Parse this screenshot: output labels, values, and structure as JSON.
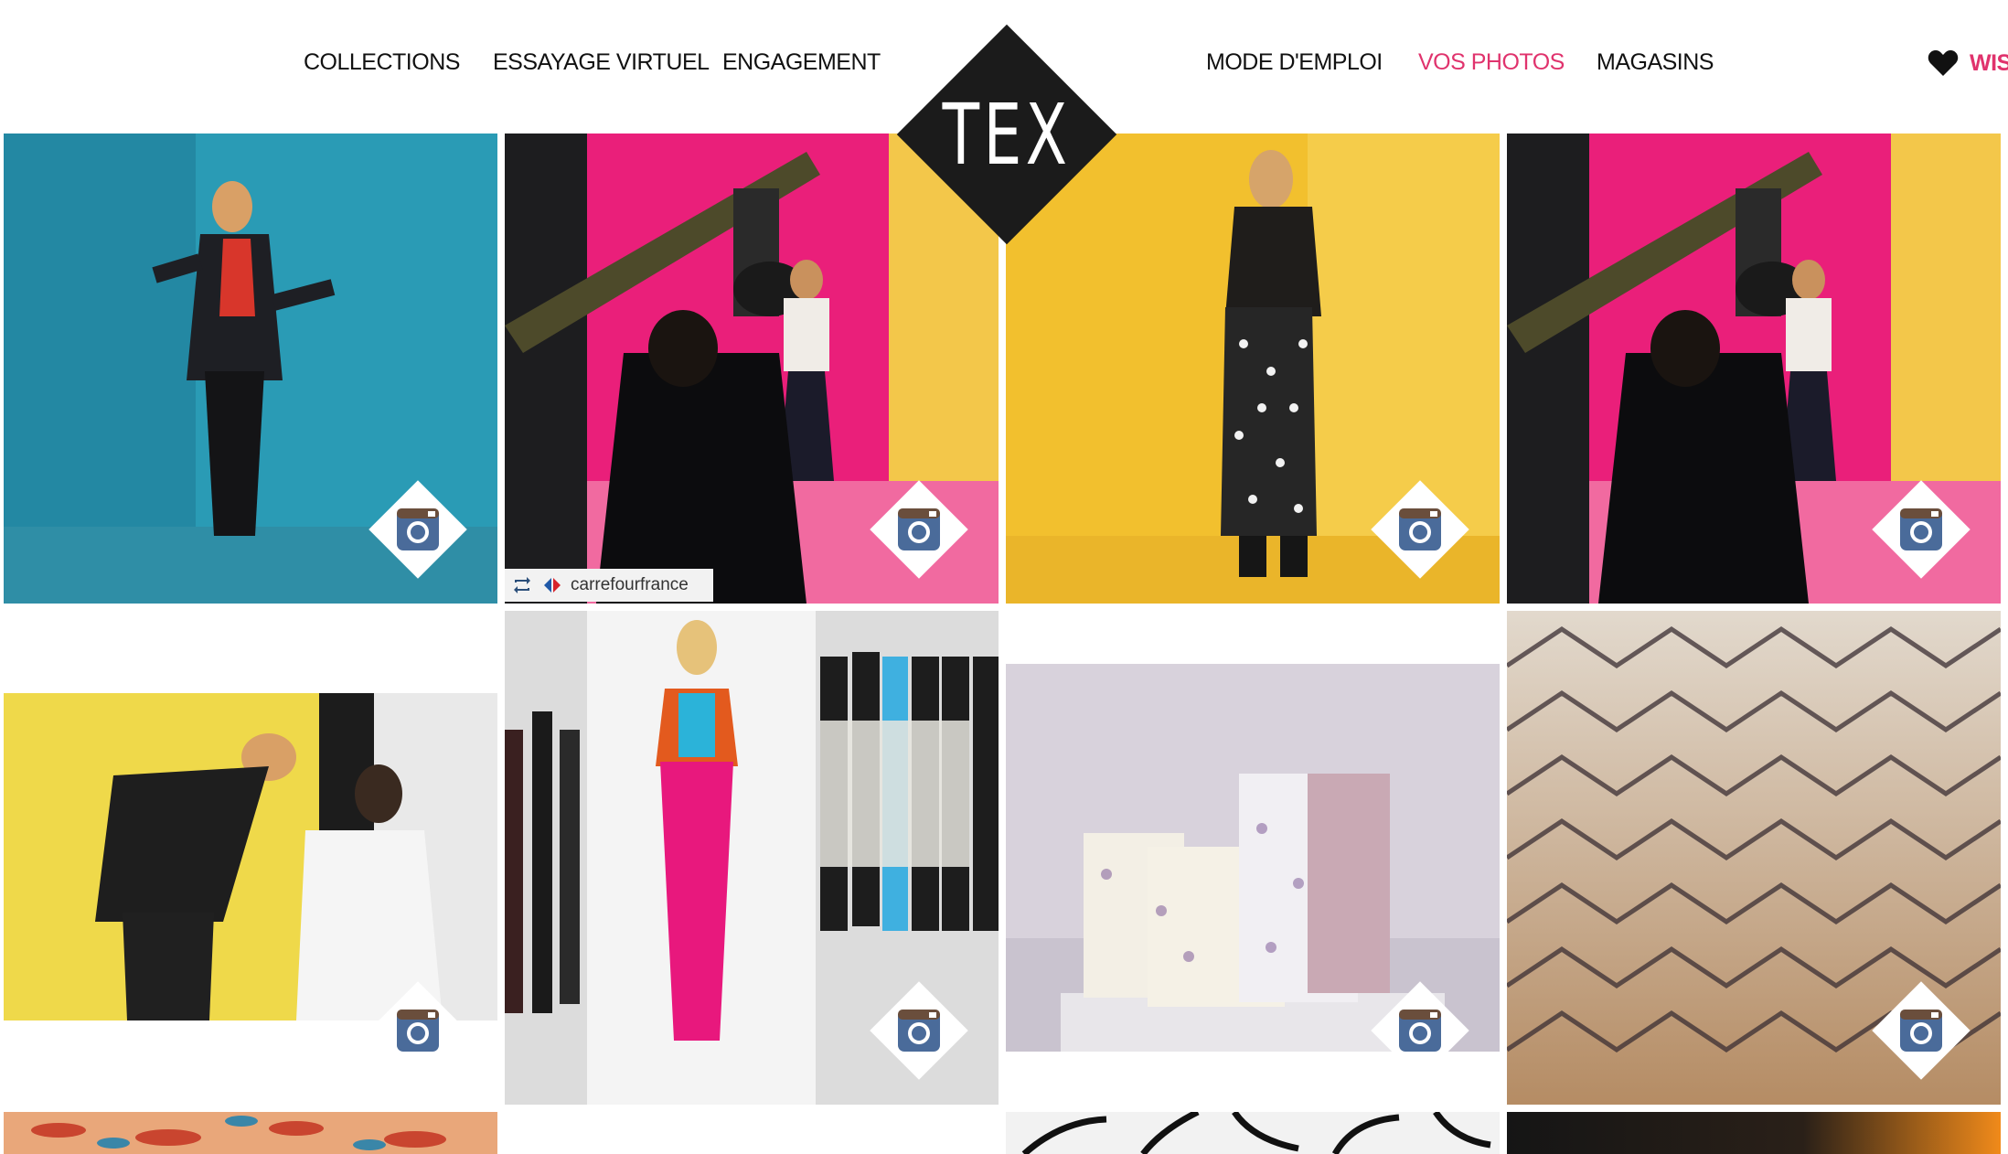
{
  "header": {
    "nav_left": [
      "COLLECTIONS",
      "ESSAYAGE VIRTUEL",
      "ENGAGEMENT"
    ],
    "nav_right": [
      "MODE D'EMPLOI",
      "VOS PHOTOS",
      "MAGASINS"
    ],
    "active": "VOS PHOTOS",
    "logo": "TEX",
    "wishlist": "WISH"
  },
  "gallery": {
    "repost_user": "carrefourfrance",
    "photos": [
      {
        "subject": "model in red blouse and black blazer against teal wall",
        "source": "instagram"
      },
      {
        "subject": "photo shoot behind the scenes with camera crane, pink backdrop",
        "source": "instagram"
      },
      {
        "subject": "model in leather jacket and printed trousers against yellow wall",
        "source": "instagram"
      },
      {
        "subject": "photo shoot behind the scenes with camera crane, pink backdrop",
        "source": "instagram"
      },
      {
        "subject": "makeup artist touching up model on yellow set",
        "source": "instagram"
      },
      {
        "subject": "fashion sketch with markers",
        "source": "instagram"
      },
      {
        "subject": "floral gift bags on a shelf",
        "source": "instagram"
      },
      {
        "subject": "close-up of patterned paper",
        "source": "instagram"
      }
    ]
  },
  "colors": {
    "accent": "#e0336d",
    "text": "#111111",
    "logo_bg": "#1b1b1b",
    "instagram_icon": "#4a6b9a"
  }
}
